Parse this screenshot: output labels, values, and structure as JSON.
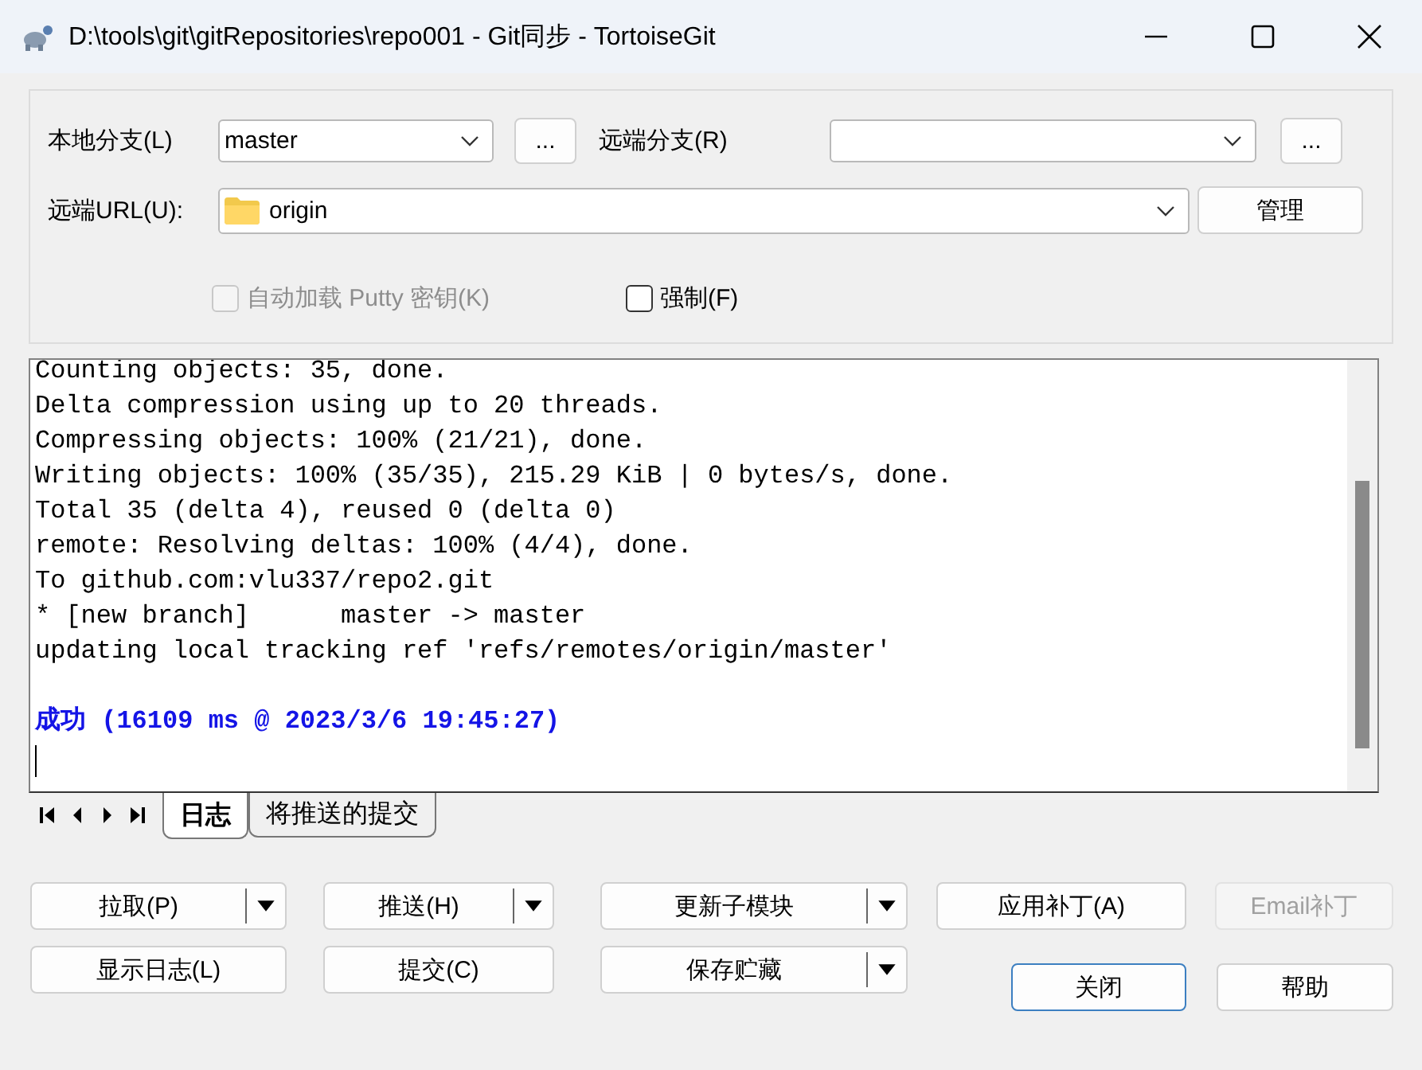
{
  "window": {
    "title": "D:\\tools\\git\\gitRepositories\\repo001 - Git同步 - TortoiseGit"
  },
  "local_branch": {
    "label": "本地分支(L)",
    "value": "master",
    "browse": "..."
  },
  "remote_branch": {
    "label": "远端分支(R)",
    "browse": "..."
  },
  "remote_url": {
    "label": "远端URL(U):",
    "value": "origin",
    "manage": "管理"
  },
  "options": [
    {
      "label": "自动加载 Putty 密钥(K)",
      "checked": false,
      "disabled": true
    },
    {
      "label": "强制(F)",
      "checked": false,
      "disabled": false
    }
  ],
  "log": {
    "lines": [
      "Counting objects: 35, done.",
      "Delta compression using up to 20 threads.",
      "Compressing objects: 100% (21/21), done.",
      "Writing objects: 100% (35/35), 215.29 KiB | 0 bytes/s, done.",
      "Total 35 (delta 4), reused 0 (delta 0)",
      "remote: Resolving deltas: 100% (4/4), done.",
      "To github.com:vlu337/repo2.git",
      "* [new branch]      master -> master",
      "updating local tracking ref 'refs/remotes/origin/master'"
    ],
    "result": "成功 (16109 ms @ 2023/3/6 19:45:27)"
  },
  "tabs": [
    {
      "label": "日志",
      "selected": true
    },
    {
      "label": "将推送的提交",
      "selected": false
    }
  ],
  "actions": [
    {
      "label": "拉取(P)",
      "kind": "split",
      "disabled": false
    },
    {
      "label": "推送(H)",
      "kind": "split",
      "disabled": false
    },
    {
      "label": "更新子模块",
      "kind": "split",
      "disabled": false
    },
    {
      "label": "应用补丁(A)",
      "kind": "plain",
      "disabled": false
    },
    {
      "label": "Email补丁",
      "kind": "plain",
      "disabled": true
    }
  ],
  "more_actions": [
    {
      "label": "显示日志(L)",
      "kind": "plain",
      "disabled": false
    },
    {
      "label": "提交(C)",
      "kind": "plain",
      "disabled": false
    },
    {
      "label": "保存贮藏",
      "kind": "split",
      "disabled": false
    }
  ],
  "dialog_buttons": [
    {
      "label": "关闭",
      "default": true
    },
    {
      "label": "帮助",
      "default": false
    }
  ]
}
